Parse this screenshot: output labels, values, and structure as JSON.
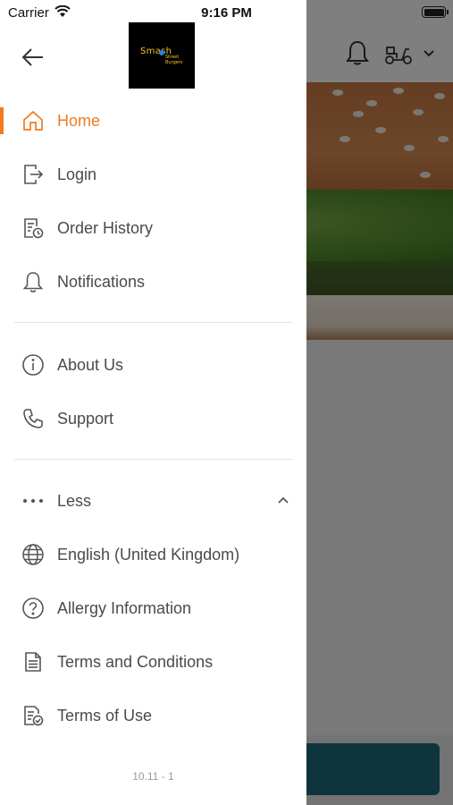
{
  "status_bar": {
    "carrier": "Carrier",
    "time": "9:16 PM"
  },
  "header": {
    "logo_line1": "Smash",
    "logo_line2a": "Street",
    "logo_line2b": "Burgers"
  },
  "menu": {
    "primary": [
      {
        "label": "Home",
        "icon": "home-icon",
        "active": true
      },
      {
        "label": "Login",
        "icon": "login-icon"
      },
      {
        "label": "Order History",
        "icon": "order-history-icon"
      },
      {
        "label": "Notifications",
        "icon": "bell-icon"
      }
    ],
    "secondary": [
      {
        "label": "About Us",
        "icon": "info-icon"
      },
      {
        "label": "Support",
        "icon": "phone-icon"
      }
    ],
    "more": {
      "label": "Less",
      "icon": "more-dots-icon",
      "chevron": "chevron-up-icon"
    },
    "extra": [
      {
        "label": "English (United Kingdom)",
        "icon": "globe-icon"
      },
      {
        "label": "Allergy Information",
        "icon": "question-icon"
      },
      {
        "label": "Terms and Conditions",
        "icon": "document-icon"
      },
      {
        "label": "Terms of Use",
        "icon": "document-check-icon"
      }
    ]
  },
  "version": "10.11 - 1",
  "colors": {
    "accent": "#f07b20",
    "text": "#4a4a4a",
    "icon": "#555555"
  }
}
